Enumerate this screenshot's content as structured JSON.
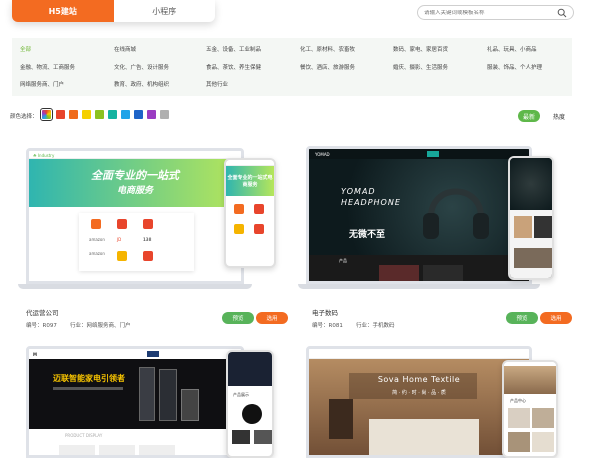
{
  "tabs": [
    {
      "label": "H5建站",
      "active": true
    },
    {
      "label": "小程序",
      "active": false
    }
  ],
  "search": {
    "placeholder": "请输入关键词或模板名称"
  },
  "categories": [
    [
      "全部",
      "在线商城",
      "五金、设备、工业制品",
      "化工、原材料、农畜牧",
      "数码、家电、家居百货",
      "礼品、玩具、小商品"
    ],
    [
      "金融、物流、工商服务",
      "文化、广告、设计服务",
      "食品、茶饮、养生保健",
      "餐饮、酒店、旅游服务",
      "婚庆、摄影、生活服务",
      "服装、饰品、个人护理"
    ],
    [
      "网络服务商、门户",
      "教育、政府、机构组织",
      "其他行业"
    ]
  ],
  "color_label": "颜色选择：",
  "colors": [
    "#e8452c",
    "#f06a1a",
    "#f5d000",
    "#8dc21f",
    "#15b3a0",
    "#1fa3e8",
    "#1e64c8",
    "#9a3cc2",
    "#b0b0b0"
  ],
  "sort": {
    "new": "最新",
    "hot": "热度"
  },
  "buttons": {
    "preview": "预览",
    "use": "选用"
  },
  "cards": [
    {
      "title": "代运营公司",
      "code": "编号：R097",
      "industry": "行业：网络服务商、门户",
      "banner": "全面专业的一站式",
      "banner2": "电商服务",
      "phone_banner": "全面专业的一站式电商服务",
      "badges": [
        "天猫",
        "淘宝",
        "京东",
        "amazon",
        "JD",
        "138",
        "amazon",
        "淘",
        "京"
      ]
    },
    {
      "title": "电子数码",
      "code": "编号：R081",
      "industry": "行业：手机数码",
      "brand": "YOMAD",
      "hero1": "YOMAD",
      "hero2": "HEADPHONE",
      "slogan": "无微不至",
      "section": "产品"
    },
    {
      "title": "",
      "banner": "迈联智能家电引领者",
      "sub": "PRODUCT DISPLAY",
      "section": "产品展示"
    },
    {
      "title": "",
      "hero": "Sova  Home Textile",
      "sub": "简 · 约 · 时 · 尚 · 品 · 质",
      "section": "产品中心"
    }
  ]
}
